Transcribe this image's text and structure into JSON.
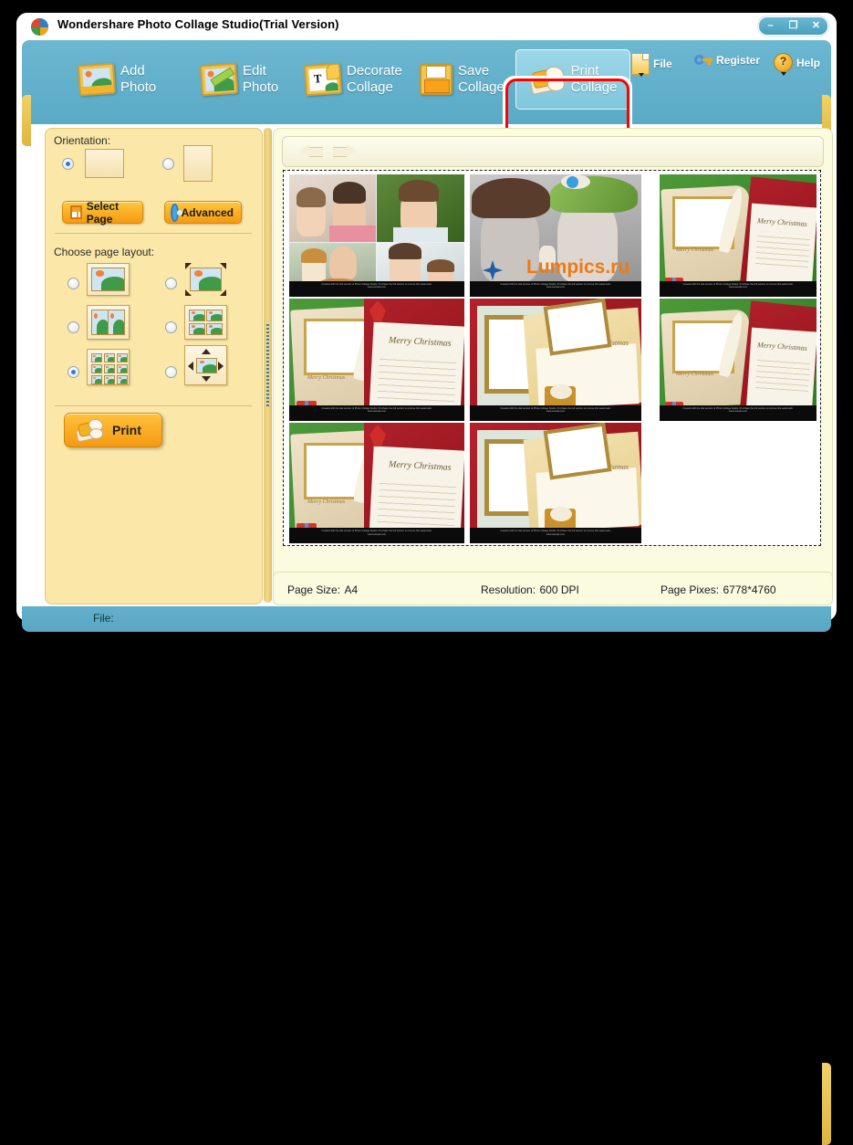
{
  "window": {
    "title": "Wondershare Photo Collage Studio(Trial Version)",
    "app_icon": "app-logo-icon",
    "controls": {
      "minimize": "–",
      "maximize": "❐",
      "close": "✕"
    }
  },
  "toolbar": {
    "buttons": [
      {
        "id": "add-photo",
        "line1": "Add",
        "line2": "Photo",
        "icon": "photo-frame-icon",
        "active": false
      },
      {
        "id": "edit-photo",
        "line1": "Edit",
        "line2": "Photo",
        "icon": "photo-pencil-icon",
        "active": false
      },
      {
        "id": "decorate-collage",
        "line1": "Decorate",
        "line2": "Collage",
        "icon": "photo-text-icon",
        "active": false
      },
      {
        "id": "save-collage",
        "line1": "Save",
        "line2": "Collage",
        "icon": "floppy-disk-icon",
        "active": false
      },
      {
        "id": "print-collage",
        "line1": "Print",
        "line2": "Collage",
        "icon": "printer-icon",
        "active": true
      }
    ],
    "mini_buttons": [
      {
        "id": "file",
        "label": "File",
        "icon": "document-icon",
        "has_caret": true
      },
      {
        "id": "register",
        "label": "Register",
        "icon": "key-icon",
        "has_caret": false
      },
      {
        "id": "help",
        "label": "Help",
        "icon": "question-circle-icon",
        "has_caret": true
      }
    ]
  },
  "sidebar": {
    "orientation_label": "Orientation:",
    "orientation_options": [
      {
        "id": "landscape",
        "selected": true
      },
      {
        "id": "portrait",
        "selected": false
      }
    ],
    "buttons": [
      {
        "id": "select-page",
        "label": "Select Page",
        "icon": "page-grid-icon"
      },
      {
        "id": "advanced",
        "label": "Advanced",
        "icon": "gear-icon"
      }
    ],
    "layout_label": "Choose page layout:",
    "layouts": [
      {
        "id": "single",
        "selected": false
      },
      {
        "id": "single-resizable",
        "selected": false
      },
      {
        "id": "two-up",
        "selected": false
      },
      {
        "id": "four-up",
        "selected": false
      },
      {
        "id": "nine-up",
        "selected": true
      },
      {
        "id": "free-position",
        "selected": false
      }
    ],
    "print_button": {
      "label": "Print",
      "icon": "printer-icon"
    }
  },
  "preview": {
    "nav": {
      "prev": "previous-page-arrow",
      "next": "next-page-arrow"
    },
    "watermark_text_line1": "Created with the trial version of Photo Collage Studio. Purchase the full version to remove this watermark.",
    "watermark_text_line2": "www.sample.com",
    "overlay_watermark": "Lumpics.ru",
    "thumbnails": [
      {
        "id": "thumb-1",
        "kind": "family-photo-collage",
        "caption": "Family photo collage"
      },
      {
        "id": "thumb-2",
        "kind": "kids-hats-photo",
        "caption": "Two girls with hats"
      },
      {
        "id": "thumb-3",
        "kind": "xmas-green-book",
        "caption": "Merry Christmas green book card"
      },
      {
        "id": "thumb-4",
        "kind": "xmas-green-book",
        "caption": "Merry Christmas green book card"
      },
      {
        "id": "thumb-5",
        "kind": "xmas-red-frames",
        "caption": "Merry Christmas red frames card"
      },
      {
        "id": "thumb-6",
        "kind": "xmas-green-book",
        "caption": "Merry Christmas green book card"
      },
      {
        "id": "thumb-7",
        "kind": "xmas-green-book",
        "caption": "Merry Christmas green book card"
      },
      {
        "id": "thumb-8",
        "kind": "xmas-red-frames",
        "caption": "Merry Christmas red frames card"
      }
    ],
    "card_text": "Merry Christmas"
  },
  "info": {
    "page_size_label": "Page Size:",
    "page_size_value": "A4",
    "resolution_label": "Resolution:",
    "resolution_value": "600 DPI",
    "page_pixes_label": "Page Pixes:",
    "page_pixes_value": "6778*4760"
  },
  "status": {
    "file_label": "File:"
  },
  "colors": {
    "toolbar_blue": "#5aaac6",
    "panel_cream": "#fbe8a8",
    "preview_cream": "#fbfbe0",
    "accent_orange": "#f59a12",
    "highlight_red": "#ff0000"
  }
}
